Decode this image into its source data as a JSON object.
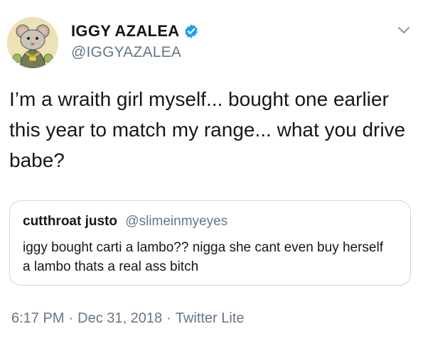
{
  "author": {
    "display_name": "IGGY AZALEA",
    "handle": "@IGGYAZALEA",
    "verified": true,
    "avatar_icon": "cartoon-rat-avatar"
  },
  "tweet": {
    "text": "I’m a wraith girl myself... bought one earlier this year to match my range... what you drive babe?"
  },
  "quoted_tweet": {
    "display_name": "cutthroat justo",
    "handle": "@slimeinmyeyes",
    "text": "iggy bought carti a lambo?? nigga she cant even buy herself a lambo thats a real ass bitch"
  },
  "meta": {
    "time": "6:17 PM",
    "date": "Dec 31, 2018",
    "source": "Twitter Lite",
    "separator": "·"
  },
  "icons": {
    "verified": "verified-badge-icon",
    "menu": "chevron-down-icon"
  },
  "colors": {
    "text": "#14171a",
    "secondary": "#657786",
    "verified_blue": "#1da1f2",
    "border": "#ccd6dd"
  }
}
